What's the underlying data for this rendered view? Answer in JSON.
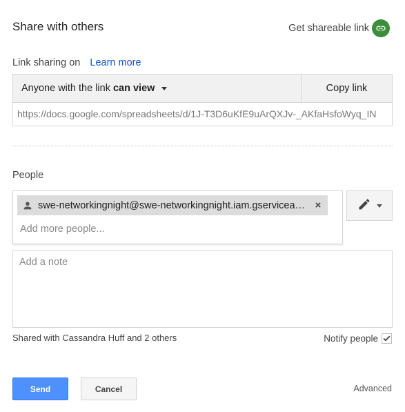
{
  "dialog": {
    "title": "Share with others",
    "shareable_link_label": "Get shareable link",
    "shareable_link_icon": "link-icon",
    "accent_green": "#3c8e3a"
  },
  "link_sharing": {
    "status_label": "Link sharing on",
    "learn_more": "Learn more",
    "access_prefix": "Anyone with the link",
    "access_level": "can view",
    "copy_link": "Copy link",
    "url": "https://docs.google.com/spreadsheets/d/1J-T3D6uKfE9uArQXJv-_AKfaHsfoWyq_IN"
  },
  "people": {
    "label": "People",
    "chips": [
      {
        "email": "swe-networkingnight@swe-networkingnight.iam.gserviceaccount.com",
        "icon": "person-icon"
      }
    ],
    "add_placeholder": "Add more people...",
    "permission_icon": "pencil-icon"
  },
  "note": {
    "placeholder": "Add a note"
  },
  "footer": {
    "shared_with": "Shared with Cassandra Huff and 2 others",
    "notify_label": "Notify people",
    "notify_checked": true,
    "send": "Send",
    "cancel": "Cancel",
    "advanced": "Advanced",
    "send_color": "#4d90fe"
  }
}
